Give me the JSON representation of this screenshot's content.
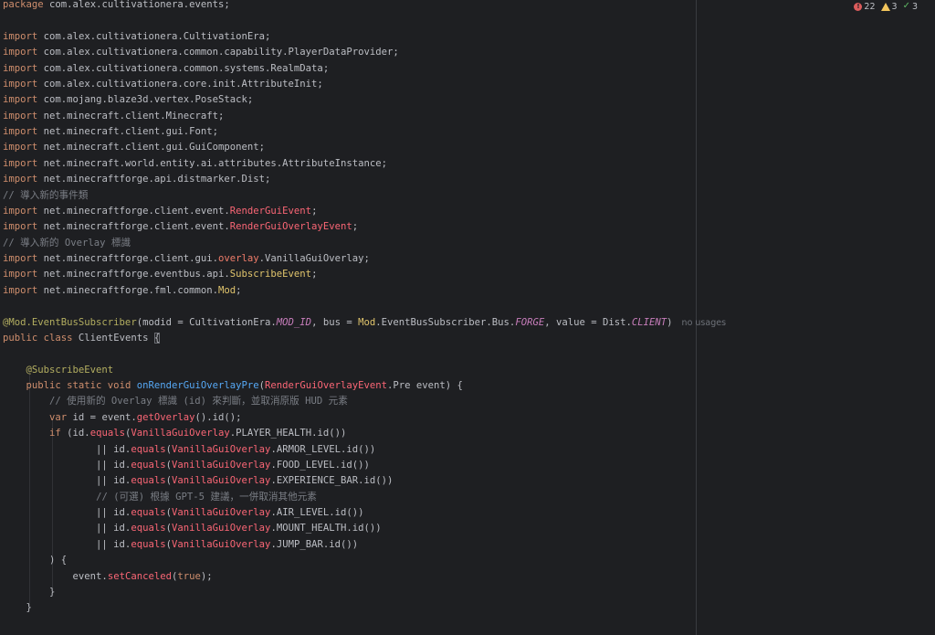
{
  "inspection": {
    "errors": "22",
    "warnings": "3",
    "weak_warnings": "3"
  },
  "usage_hint": "no usages",
  "code": {
    "package": "com.alex.cultivationera.events;",
    "imports": [
      "com.alex.cultivationera.CultivationEra;",
      "com.alex.cultivationera.common.capability.PlayerDataProvider;",
      "com.alex.cultivationera.common.systems.RealmData;",
      "com.alex.cultivationera.core.init.AttributeInit;",
      "com.mojang.blaze3d.vertex.PoseStack;",
      "net.minecraft.client.Minecraft;",
      "net.minecraft.client.gui.Font;",
      "net.minecraft.client.gui.GuiComponent;",
      "net.minecraft.world.entity.ai.attributes.AttributeInstance;",
      "net.minecraftforge.api.distmarker.Dist;"
    ],
    "comment_new_events": "// 導入新的事件類",
    "comment_new_overlay": "// 導入新的 Overlay 標識",
    "comment_use_overlay": "// 使用新的 Overlay 標識 (id) 來判斷，並取消原版 HUD 元素",
    "comment_optional": "// (可選) 根據 GPT-5 建議，一併取消其他元素"
  },
  "colors": {
    "background": "#1e1f22",
    "keyword": "#cf8e6d",
    "annotation": "#b3ae60",
    "method_decl": "#56a8f5",
    "static_field": "#c77dbb",
    "comment": "#7a7e85",
    "error_text": "#fa6675",
    "error_badge": "#db5c5c",
    "warning_badge": "#f2c55c",
    "ok_badge": "#5fb865"
  }
}
